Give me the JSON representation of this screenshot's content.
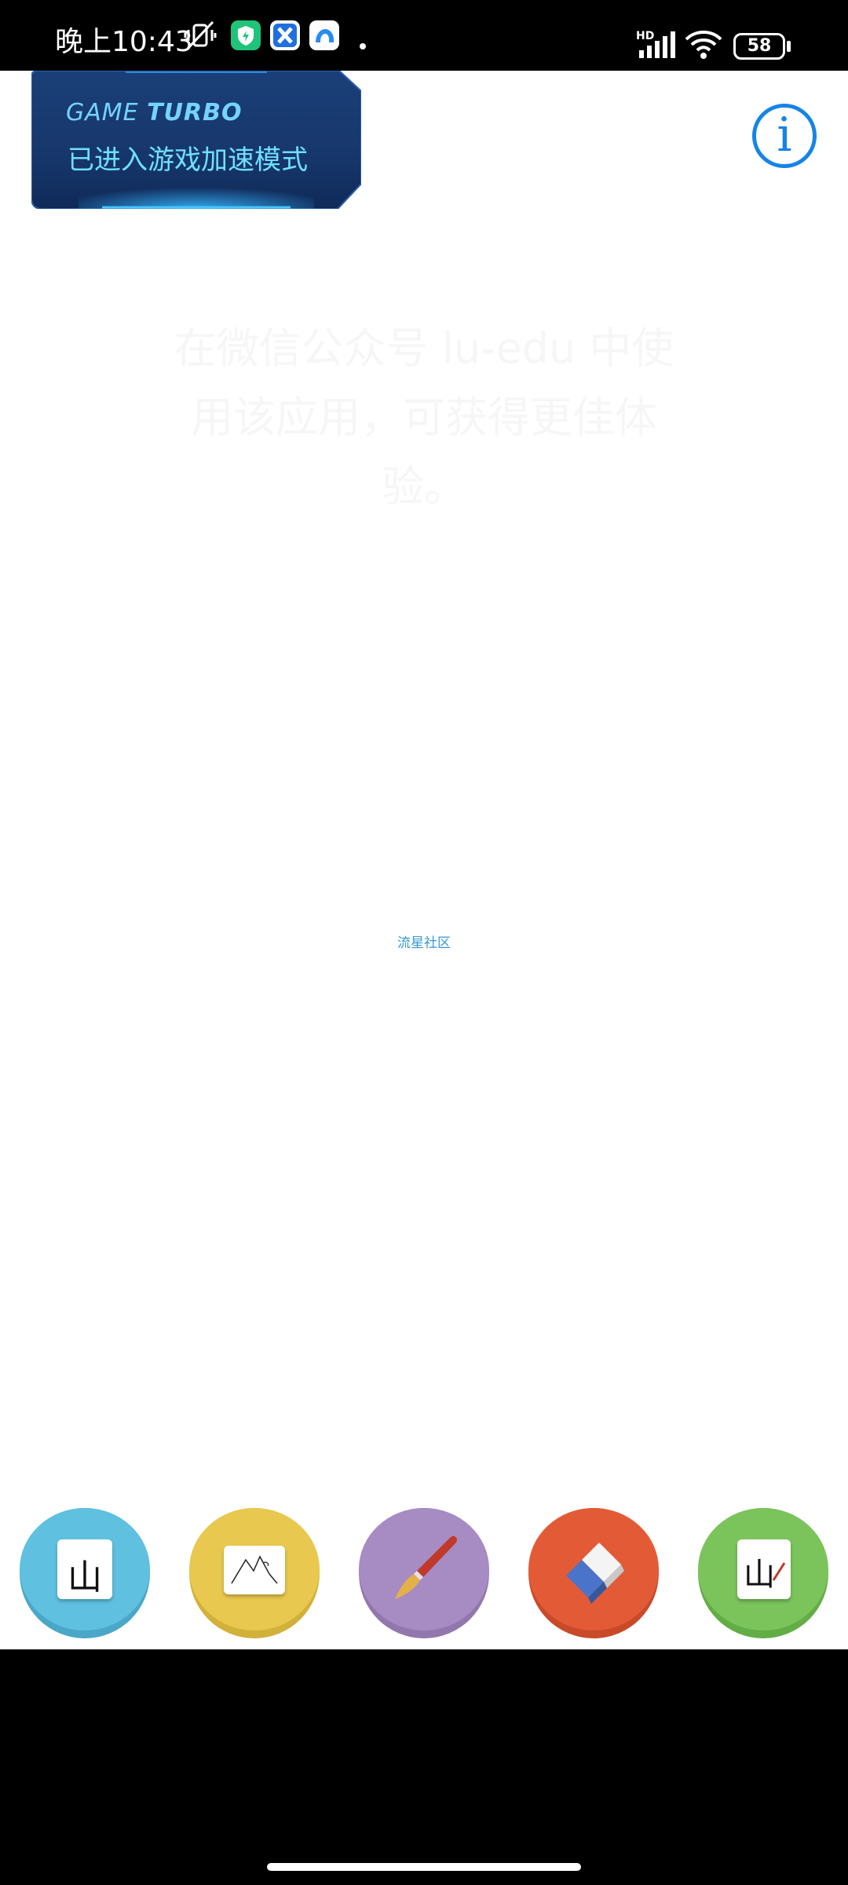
{
  "status_bar": {
    "time": "晚上10:43",
    "network_label": "HD",
    "battery_level": "58",
    "battery_fraction": 0.58
  },
  "game_turbo": {
    "brand_light": "GAME",
    "brand_bold": "TURBO",
    "message": "已进入游戏加速模式"
  },
  "main": {
    "faded_hint": "在微信公众号 lu-edu 中使用该应用，可获得更佳体验。",
    "community_link": "流星社区"
  },
  "toolbar": {
    "tools": [
      {
        "name": "character-mode",
        "color": "#5fc0e0",
        "shade": "#4aa7c8",
        "char": "山"
      },
      {
        "name": "picture-mode",
        "color": "#e8c84e",
        "shade": "#d2b13a"
      },
      {
        "name": "brush",
        "color": "#a78bc3",
        "shade": "#9277ad"
      },
      {
        "name": "eraser",
        "color": "#e35b36",
        "shade": "#c94a28"
      },
      {
        "name": "write-mode",
        "color": "#7bc45c",
        "shade": "#63ad46",
        "char": "山"
      }
    ]
  },
  "colors": {
    "accent": "#1784e5",
    "turbo_text": "#6fe0ff"
  }
}
